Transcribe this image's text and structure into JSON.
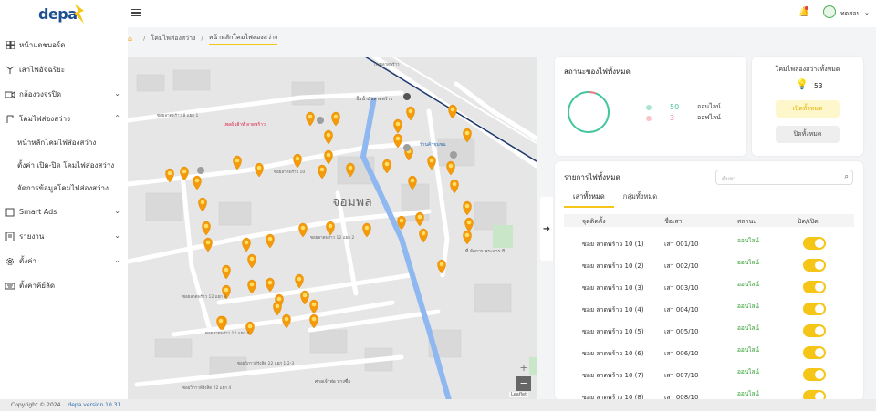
{
  "logo": {
    "text": "depa"
  },
  "nav": {
    "items": [
      {
        "label": "หน้าแดชบอร์ด",
        "icon": "dashboard-icon"
      },
      {
        "label": "เสาไฟอัจฉริยะ",
        "icon": "antenna-icon"
      },
      {
        "label": "กล้องวงจรปิด",
        "icon": "camera-icon"
      },
      {
        "label": "โคมไฟส่องสว่าง",
        "icon": "lamp-icon"
      }
    ],
    "sub": [
      "หน้าหลักโคมไฟส่องสว่าง",
      "ตั้งค่า เปิด-ปิด โคมไฟส่องสว่าง",
      "จัดการข้อมูลโคมไฟส่องสว่าง"
    ],
    "items2": [
      {
        "label": "Smart Ads",
        "icon": "ads-icon"
      },
      {
        "label": "รายงาน",
        "icon": "report-icon"
      },
      {
        "label": "ตั้งค่า",
        "icon": "gear-icon"
      },
      {
        "label": "ตั้งค่าคีย์ลัด",
        "icon": "keyboard-icon"
      }
    ]
  },
  "topbar": {
    "user": "ทดสอบ"
  },
  "breadcrumb": {
    "level1": "โคมไฟส่องสว่าง",
    "current": "หน้าหลักโคมไฟส่องสว่าง"
  },
  "map": {
    "district": "จอมพล",
    "roads": [
      "ซอยลาดพร้าว 8 แยก 1",
      "ซอยลาดพร้าว 10",
      "ซอยลาดพร้าว 12 แยก 2",
      "ซอยลาดพร้าว 12 แยก 3",
      "ซอยลาดพร้าว 12 แยก 4",
      "ถนนลาดพร้าว",
      "ซอยวิภาวดีรังสิต 22 แยก 1-2-3",
      "ซอยวิภาวดีรังสิต 22 แยก 4"
    ],
    "places": [
      "เพลย์ เฮ้าท์ ลาดพร้าว",
      "ปั้มน้ำมันลาดพร้าว",
      "ร้านค้าชุมชน",
      "ที่ จัดการ พระสาร 8",
      "ศาลเจ้าพ่อ บางซื่อ"
    ],
    "zoom_in": "+",
    "zoom_out": "−",
    "attribution": "Leaflet"
  },
  "status": {
    "title": "สถานะของไฟทั้งหมด",
    "online_count": "50",
    "online_label": "ออนไลน์",
    "offline_count": "3",
    "offline_label": "ออฟไลน์",
    "online_color": "#43c6a0",
    "offline_color": "#f07e8a"
  },
  "lamps": {
    "title": "โคมไฟส่องสว่างทั้งหมด",
    "count": "53",
    "on_label": "เปิดทั้งหมด",
    "off_label": "ปิดทั้งหมด"
  },
  "list": {
    "title": "รายการไฟทั้งหมด",
    "search_placeholder": "ค้นหา",
    "tabs": [
      "เสาทั้งหมด",
      "กลุ่มทั้งหมด"
    ],
    "headers": [
      "จุดติดตั้ง",
      "ชื่อเสา",
      "สถานะ",
      "ปิด/เปิด"
    ],
    "rows": [
      {
        "loc": "ซอย ลาดพร้าว 10 (1)",
        "name": "เสา 001/10",
        "status": "ออนไลน์"
      },
      {
        "loc": "ซอย ลาดพร้าว 10 (2)",
        "name": "เสา 002/10",
        "status": "ออนไลน์"
      },
      {
        "loc": "ซอย ลาดพร้าว 10 (3)",
        "name": "เสา 003/10",
        "status": "ออนไลน์"
      },
      {
        "loc": "ซอย ลาดพร้าว 10 (4)",
        "name": "เสา 004/10",
        "status": "ออนไลน์"
      },
      {
        "loc": "ซอย ลาดพร้าว 10 (5)",
        "name": "เสา 005/10",
        "status": "ออนไลน์"
      },
      {
        "loc": "ซอย ลาดพร้าว 10 (6)",
        "name": "เสา 006/10",
        "status": "ออนไลน์"
      },
      {
        "loc": "ซอย ลาดพร้าว 10 (7)",
        "name": "เสา 007/10",
        "status": "ออนไลน์"
      },
      {
        "loc": "ซอย ลาดพร้าว 10 (8)",
        "name": "เสา 008/10",
        "status": "ออนไลน์"
      }
    ]
  },
  "footer": {
    "copyright": "Copyright © 2024",
    "version": "depa version 10.31"
  }
}
